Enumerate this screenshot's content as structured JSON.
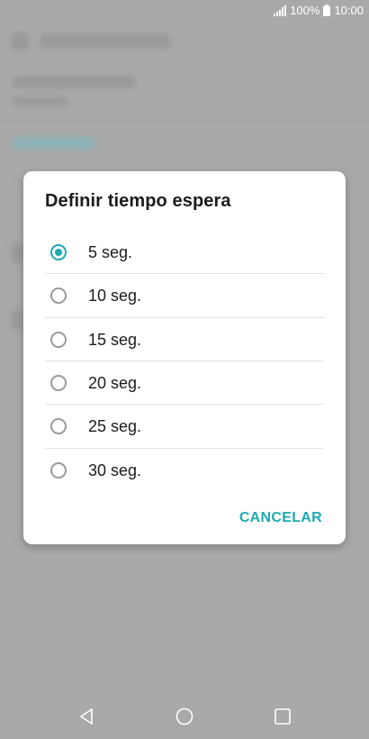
{
  "status_bar": {
    "battery_percent": "100%",
    "time": "10:00"
  },
  "dialog": {
    "title": "Definir tiempo espera",
    "options": [
      {
        "label": "5 seg.",
        "selected": true
      },
      {
        "label": "10 seg.",
        "selected": false
      },
      {
        "label": "15 seg.",
        "selected": false
      },
      {
        "label": "20 seg.",
        "selected": false
      },
      {
        "label": "25 seg.",
        "selected": false
      },
      {
        "label": "30 seg.",
        "selected": false
      }
    ],
    "cancel_label": "CANCELAR"
  },
  "colors": {
    "accent": "#1ea9b3",
    "scrim": "#a9a9a9",
    "dialog_background": "#ffffff"
  },
  "icons": {
    "signal": "signal-icon",
    "battery": "battery-icon",
    "back": "back-icon",
    "home": "home-icon",
    "recents": "recents-icon"
  }
}
